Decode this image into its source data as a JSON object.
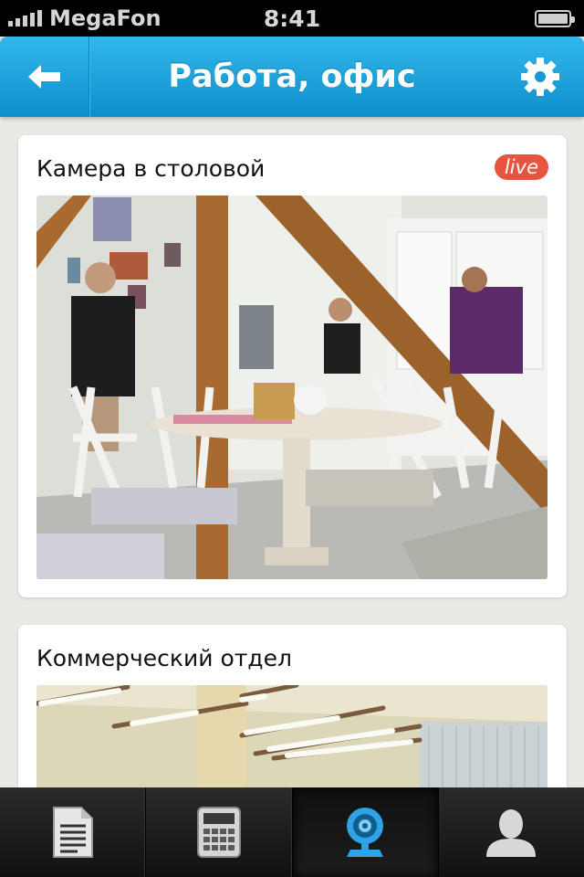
{
  "status_bar": {
    "carrier": "MegaFon",
    "time": "8:41"
  },
  "nav": {
    "title": "Работа, офис",
    "back_icon": "arrow-left-icon",
    "settings_icon": "gear-icon"
  },
  "cameras": [
    {
      "title": "Камера в столовой",
      "badge": "live"
    },
    {
      "title": "Коммерческий отдел"
    }
  ],
  "tabs": [
    {
      "icon": "document-icon"
    },
    {
      "icon": "calculator-icon"
    },
    {
      "icon": "webcam-icon",
      "active": true
    },
    {
      "icon": "user-icon"
    }
  ],
  "colors": {
    "nav_blue": "#1ea3dc",
    "live_badge": "#e5553f",
    "active_tab_icon": "#2ea3e6"
  }
}
